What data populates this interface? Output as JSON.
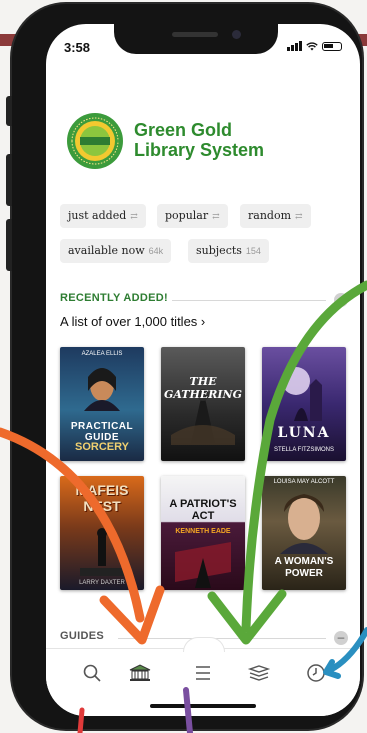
{
  "status": {
    "time": "3:58"
  },
  "brand": {
    "name_line1": "Green Gold",
    "name_line2": "Library System",
    "color": "#2e8b2e",
    "logo_ring_top": "Sharing Success",
    "logo_ring_bottom": "Sharing the Future",
    "logo_center": "GREEN GOLD"
  },
  "chips": [
    {
      "label": "just added",
      "count": ""
    },
    {
      "label": "popular",
      "count": ""
    },
    {
      "label": "random",
      "count": ""
    },
    {
      "label": "available now",
      "count": "64k"
    },
    {
      "label": "subjects",
      "count": "154"
    }
  ],
  "recent": {
    "title": "RECENTLY ADDED!",
    "subtitle": "A list of over 1,000 titles",
    "books": [
      {
        "title_top": "PRACTICAL GUIDE",
        "title_bottom": "SORCERY",
        "author": "AZALEA ELLIS",
        "color": "#2f4f7f"
      },
      {
        "title_top": "THE GATHERING",
        "title_bottom": "",
        "author": "",
        "color": "#3d3d3d"
      },
      {
        "title_top": "LUNA",
        "title_bottom": "",
        "author": "STELLA FITZSIMONS",
        "color": "#3b2a5e"
      },
      {
        "title_top": "MAFEIS NEST",
        "title_bottom": "",
        "author": "LARRY DAXTER",
        "color": "#4a2a1a"
      },
      {
        "title_top": "A PATRIOT'S ACT",
        "title_bottom": "",
        "author": "KENNETH EADE",
        "color": "#5a1a2a"
      },
      {
        "title_top": "A WOMAN'S POWER",
        "title_bottom": "",
        "author": "LOUISA MAY ALCOTT",
        "color": "#5a4a30"
      }
    ]
  },
  "guides": {
    "title": "GUIDES"
  },
  "tabs": [
    {
      "name": "search-icon"
    },
    {
      "name": "library-icon"
    },
    {
      "name": "menu-icon"
    },
    {
      "name": "books-stack-icon"
    },
    {
      "name": "clock-icon"
    }
  ],
  "annotation_colors": {
    "orange": "#ee6a2c",
    "green": "#5aa83a",
    "blue": "#2a8fc0",
    "red": "#e03a3a",
    "purple": "#7a4fa0"
  }
}
